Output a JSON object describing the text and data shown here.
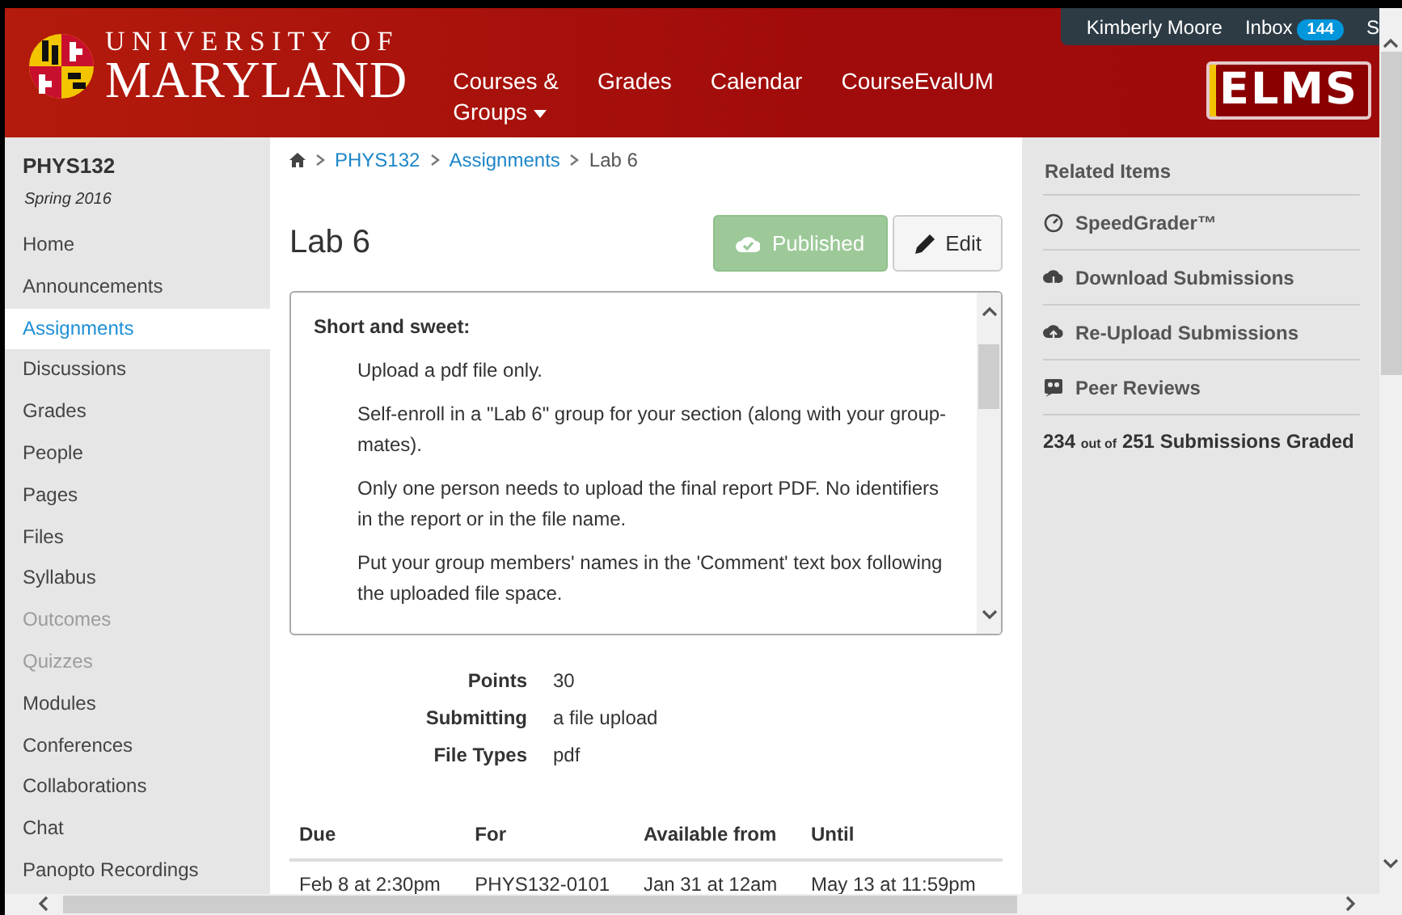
{
  "header": {
    "logo_top": "UNIVERSITY OF",
    "logo_bottom": "MARYLAND",
    "nav": [
      {
        "label": "Courses &",
        "label2": "Groups",
        "dropdown": true
      },
      {
        "label": "Grades",
        "dropdown": false
      },
      {
        "label": "Calendar",
        "dropdown": false
      },
      {
        "label": "CourseEvalUM",
        "dropdown": false
      }
    ],
    "user": "Kimberly Moore",
    "inbox": "Inbox",
    "inbox_count": "144",
    "cut_link": "S",
    "brand": "ELMS"
  },
  "sidebar": {
    "course": "PHYS132",
    "term": "Spring 2016",
    "items": [
      {
        "label": "Home",
        "selected": false,
        "disabled": false
      },
      {
        "label": "Announcements",
        "selected": false,
        "disabled": false
      },
      {
        "label": "Assignments",
        "selected": true,
        "disabled": false
      },
      {
        "label": "Discussions",
        "selected": false,
        "disabled": false
      },
      {
        "label": "Grades",
        "selected": false,
        "disabled": false
      },
      {
        "label": "People",
        "selected": false,
        "disabled": false
      },
      {
        "label": "Pages",
        "selected": false,
        "disabled": false
      },
      {
        "label": "Files",
        "selected": false,
        "disabled": false
      },
      {
        "label": "Syllabus",
        "selected": false,
        "disabled": false
      },
      {
        "label": "Outcomes",
        "selected": false,
        "disabled": true
      },
      {
        "label": "Quizzes",
        "selected": false,
        "disabled": true
      },
      {
        "label": "Modules",
        "selected": false,
        "disabled": false
      },
      {
        "label": "Conferences",
        "selected": false,
        "disabled": false
      },
      {
        "label": "Collaborations",
        "selected": false,
        "disabled": false
      },
      {
        "label": "Chat",
        "selected": false,
        "disabled": false
      },
      {
        "label": "Panopto Recordings",
        "selected": false,
        "disabled": false
      }
    ]
  },
  "breadcrumb": [
    "PHYS132",
    "Assignments",
    "Lab 6"
  ],
  "title": "Lab 6",
  "published_button": "Published",
  "edit_button": "Edit",
  "description": {
    "heading": "Short and sweet:",
    "paragraphs": [
      "Upload a pdf file only.",
      "Self-enroll in a \"Lab 6\" group for your section (along with your group-mates).",
      "Only one person needs to upload the final report PDF.  No identifiers in the report or in the file name.",
      "Put your group members' names in the 'Comment' text box following the uploaded file space."
    ]
  },
  "details": [
    {
      "label": "Points",
      "value": "30"
    },
    {
      "label": "Submitting",
      "value": "a file upload"
    },
    {
      "label": "File Types",
      "value": "pdf"
    }
  ],
  "dates_table": {
    "columns": [
      "Due",
      "For",
      "Available from",
      "Until"
    ],
    "rows": [
      [
        "Feb 8 at 2:30pm",
        "PHYS132-0101",
        "Jan 31 at 12am",
        "May 13 at 11:59pm"
      ]
    ]
  },
  "related": {
    "title": "Related Items",
    "items": [
      {
        "kind": "speed",
        "label": "SpeedGrader™"
      },
      {
        "kind": "download",
        "label": "Download Submissions"
      },
      {
        "kind": "upload",
        "label": "Re-Upload Submissions"
      },
      {
        "kind": "peer",
        "label": "Peer Reviews"
      }
    ],
    "graded": "234",
    "out_of": "out of",
    "total": "251",
    "graded_label": "Submissions Graded"
  }
}
